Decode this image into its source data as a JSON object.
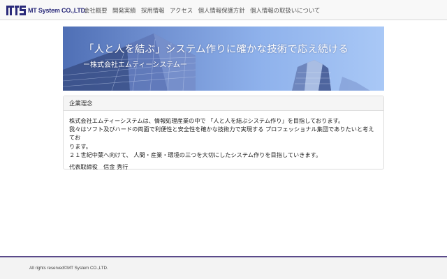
{
  "header": {
    "logo_text": "MT System CO.,LTD.",
    "nav": [
      {
        "label": "会社概要"
      },
      {
        "label": "開発実績"
      },
      {
        "label": "採用情報"
      },
      {
        "label": "アクセス"
      },
      {
        "label": "個人情報保護方針"
      },
      {
        "label": "個人情報の取扱いについて"
      }
    ]
  },
  "hero": {
    "title": "「人と人を結ぶ」システム作りに確かな技術で応え続ける",
    "subtitle": "ー株式会社エムティーシステムー"
  },
  "philosophy": {
    "heading": "企業理念",
    "lines": [
      "株式会社エムティーシステムは、情報処理産業の中で 「人と人を結ぶシステム作り」を目指しております。",
      "我々はソフト及びハードの両面で利便性と安全性を確かな技術力で実現する プロフェッショナル集団でありたいと考えてお",
      "ります。",
      "２１世紀中葉へ向けて、 人間・産業・環境の三つを大切にしたシステム作りを目指していきます。"
    ],
    "signature": "代表取締役　信金 秀行"
  },
  "footer": {
    "copyright": "All rights reserved©MT System CO.,LTD."
  },
  "colors": {
    "logo": "#2a2a7a",
    "footer_accent": "#5a4a8a",
    "hero_sky": "#8fb2ec"
  }
}
